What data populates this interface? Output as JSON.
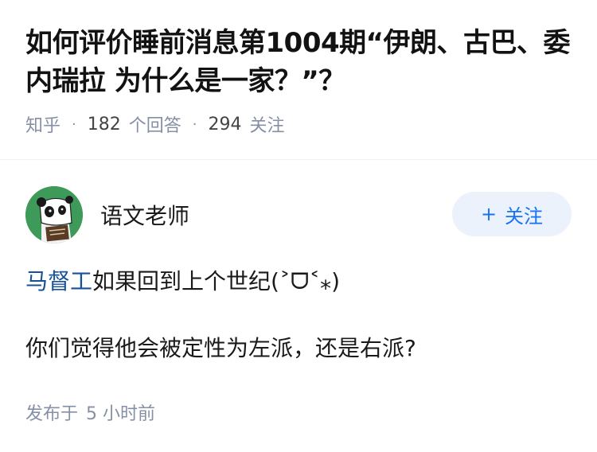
{
  "question": {
    "title": "如何评价睡前消息第1004期“伊朗、古巴、委内瑞拉 为什么是一家？”？",
    "source": "知乎",
    "separator": "·",
    "answer_count": "182",
    "answer_label": "个回答",
    "follower_count": "294",
    "follower_label": "关注"
  },
  "author": {
    "name": "语文老师",
    "avatar_icon": "panda-cartoon-avatar",
    "follow_plus": "+",
    "follow_label": "关注"
  },
  "answer": {
    "mention": "马督工",
    "line1_rest": "如果回到上个世纪(˃ᗜ˂⁎)",
    "line2": "你们觉得他会被定性为左派，还是右派?"
  },
  "post": {
    "published_label": "发布于",
    "time": "5 小时前"
  },
  "colors": {
    "accent": "#1772f6",
    "mention": "#175199",
    "meta": "#8590a6",
    "button_bg": "#ebf2fb",
    "avatar_bg": "#3e9a58"
  }
}
